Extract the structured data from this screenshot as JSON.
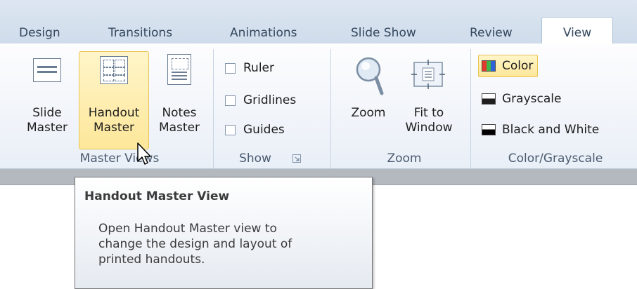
{
  "tabs": [
    {
      "label": "Design"
    },
    {
      "label": "Transitions"
    },
    {
      "label": "Animations"
    },
    {
      "label": "Slide Show"
    },
    {
      "label": "Review"
    },
    {
      "label": "View",
      "active": true
    }
  ],
  "master_views": {
    "label": "Master Views",
    "buttons": [
      {
        "line1": "Slide",
        "line2": "Master",
        "icon": "slide-master-icon"
      },
      {
        "line1": "Handout",
        "line2": "Master",
        "icon": "handout-master-icon",
        "hover": true
      },
      {
        "line1": "Notes",
        "line2": "Master",
        "icon": "notes-master-icon"
      }
    ]
  },
  "show": {
    "label": "Show",
    "items": [
      {
        "label": "Ruler",
        "checked": false
      },
      {
        "label": "Gridlines",
        "checked": false
      },
      {
        "label": "Guides",
        "checked": false
      }
    ]
  },
  "zoom": {
    "label": "Zoom",
    "zoom_button": "Zoom",
    "fit_line1": "Fit to",
    "fit_line2": "Window"
  },
  "color_grayscale": {
    "label": "Color/Grayscale",
    "items": [
      {
        "label": "Color",
        "selected": true
      },
      {
        "label": "Grayscale"
      },
      {
        "label": "Black and White"
      }
    ]
  },
  "tooltip": {
    "title": "Handout Master View",
    "body_line1": "Open Handout Master view to",
    "body_line2": "change the design and layout of",
    "body_line3": "printed handouts."
  },
  "colors": {
    "hover_fill": "#fde79a",
    "hover_border": "#e8c456",
    "tab_text": "#33475e"
  }
}
